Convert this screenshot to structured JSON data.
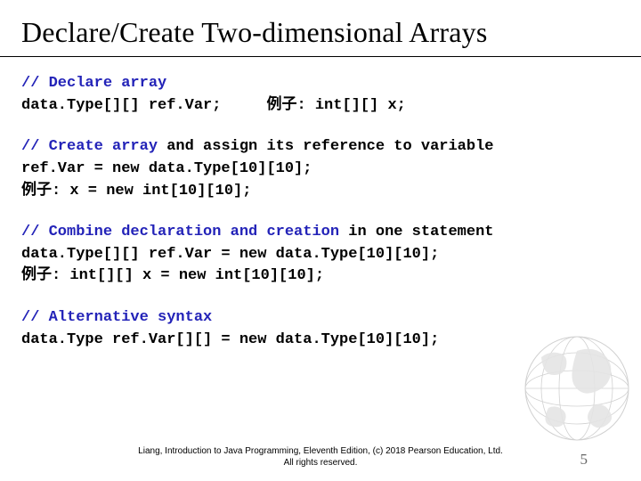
{
  "title": "Declare/Create Two-dimensional Arrays",
  "block1": {
    "comment": "// Declare array",
    "code": "data.Type[][] ref.Var;     例子: int[][] x;"
  },
  "block2": {
    "comment": "// Create array",
    "suffix": " and assign its reference to variable",
    "line1": "ref.Var = new data.Type[10][10];",
    "line2": "例子: x = new int[10][10];"
  },
  "block3": {
    "comment": "// Combine declaration and creation",
    "suffix": " in one statement",
    "line1": "data.Type[][] ref.Var = new data.Type[10][10];",
    "line2": "例子: int[][] x = new int[10][10];"
  },
  "block4": {
    "comment": "// Alternative syntax",
    "line1": "data.Type ref.Var[][] = new data.Type[10][10];"
  },
  "footer": {
    "line1": "Liang, Introduction to Java Programming, Eleventh Edition, (c) 2018 Pearson Education, Ltd.",
    "line2": "All rights reserved."
  },
  "pagenum": "5"
}
